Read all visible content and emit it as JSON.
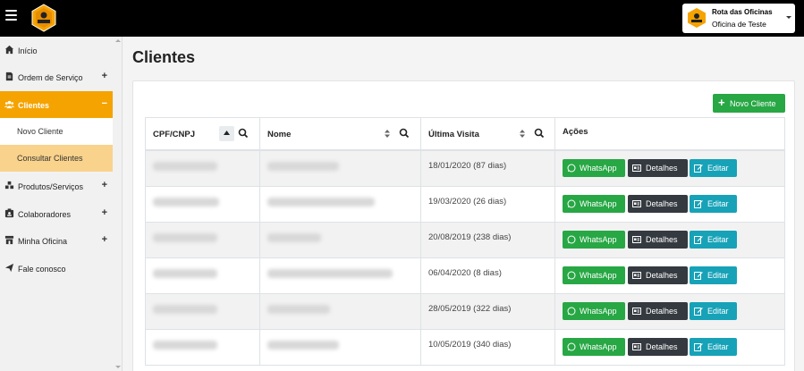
{
  "header": {
    "brand_logo_text": "ROTA DAS OFICINAS",
    "user_company": "Rota das Oficinas",
    "user_org": "Oficina de Teste"
  },
  "sidebar": {
    "items": [
      {
        "label": "Início",
        "icon": "home-icon"
      },
      {
        "label": "Ordem de Serviço",
        "icon": "document-icon"
      },
      {
        "label": "Clientes",
        "icon": "users-icon"
      },
      {
        "label": "Produtos/Serviços",
        "icon": "cubes-icon"
      },
      {
        "label": "Colaboradores",
        "icon": "id-badge-icon"
      },
      {
        "label": "Minha Oficina",
        "icon": "store-icon"
      },
      {
        "label": "Fale conosco",
        "icon": "send-icon"
      }
    ],
    "sub_items": [
      {
        "label": "Novo Cliente"
      },
      {
        "label": "Consultar Clientes"
      }
    ],
    "accent_color": "#f5a300"
  },
  "main": {
    "title": "Clientes",
    "new_button_label": "Novo Cliente",
    "columns": [
      "CPF/CNPJ",
      "Nome",
      "Última Visita",
      "Ações"
    ],
    "actions": {
      "whatsapp": "WhatsApp",
      "details": "Detalhes",
      "edit": "Editar"
    },
    "rows": [
      {
        "last_visit": "18/01/2020 (87 dias)"
      },
      {
        "last_visit": "19/03/2020 (26 dias)"
      },
      {
        "last_visit": "20/08/2019 (238 dias)"
      },
      {
        "last_visit": "06/04/2020 (8 dias)"
      },
      {
        "last_visit": "28/05/2019 (322 dias)"
      },
      {
        "last_visit": "10/05/2019 (340 dias)"
      }
    ]
  }
}
